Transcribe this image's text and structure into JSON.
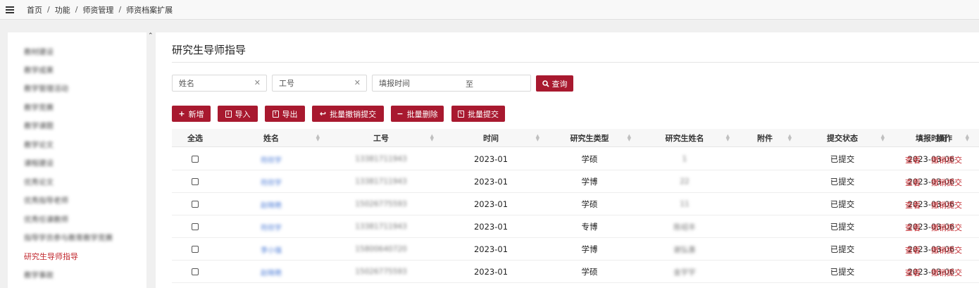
{
  "breadcrumb": [
    "首页",
    "功能",
    "师资管理",
    "师资档案扩展"
  ],
  "sidebar": {
    "items": [
      {
        "label": "教材建设",
        "blurred": true
      },
      {
        "label": "教学成果",
        "blurred": true
      },
      {
        "label": "教学管理活动",
        "blurred": true
      },
      {
        "label": "教学竞赛",
        "blurred": true
      },
      {
        "label": "教学课题",
        "blurred": true
      },
      {
        "label": "教学论文",
        "blurred": true
      },
      {
        "label": "课程建设",
        "blurred": true
      },
      {
        "label": "优秀论文",
        "blurred": true
      },
      {
        "label": "优秀指导老师",
        "blurred": true
      },
      {
        "label": "优秀任课教师",
        "blurred": true
      },
      {
        "label": "指导学员参与教育教学竞赛",
        "blurred": true
      },
      {
        "label": "研究生导师指导",
        "active": true
      },
      {
        "label": "教学事故",
        "blurred": true
      }
    ]
  },
  "page_title": "研究生导师指导",
  "search": {
    "name_placeholder": "姓名",
    "id_placeholder": "工号",
    "date_placeholder": "填报时间",
    "date_to": "至",
    "query_label": "查询"
  },
  "toolbar": {
    "add": "新增",
    "import": "导入",
    "export": "导出",
    "batch_revoke": "批量撤销提交",
    "batch_delete": "批量删除",
    "batch_submit": "批量提交"
  },
  "table": {
    "headers": [
      "全选",
      "姓名",
      "工号",
      "时间",
      "研究生类型",
      "研究生姓名",
      "附件",
      "提交状态",
      "填报时间",
      "操作"
    ],
    "rows": [
      {
        "name": "符欣宇",
        "id": "13381711943",
        "time": "2023-01",
        "type": "学硕",
        "student": "1",
        "attachment": "",
        "status": "已提交",
        "filled": "2023-03-06"
      },
      {
        "name": "符欣宇",
        "id": "13381711943",
        "time": "2023-01",
        "type": "学博",
        "student": "22",
        "attachment": "",
        "status": "已提交",
        "filled": "2023-03-06"
      },
      {
        "name": "赵晓艳",
        "id": "15026775593",
        "time": "2023-01",
        "type": "学硕",
        "student": "11",
        "attachment": "",
        "status": "已提交",
        "filled": "2023-03-06"
      },
      {
        "name": "符欣宇",
        "id": "13381711943",
        "time": "2023-01",
        "type": "专博",
        "student": "陈绍丰",
        "attachment": "",
        "status": "已提交",
        "filled": "2023-03-06"
      },
      {
        "name": "李小强",
        "id": "15800640720",
        "time": "2023-01",
        "type": "学博",
        "student": "谢弘惠",
        "attachment": "",
        "status": "已提交",
        "filled": "2023-03-06"
      },
      {
        "name": "赵晓艳",
        "id": "15026775593",
        "time": "2023-01",
        "type": "学硕",
        "student": "金宇宇",
        "attachment": "",
        "status": "已提交",
        "filled": "2023-03-06"
      }
    ],
    "actions": {
      "view": "查看",
      "revoke": "撤销提交"
    }
  },
  "colors": {
    "accent": "#a8192f",
    "link_red": "#c1272d",
    "link_blue": "#4a7ad6"
  }
}
